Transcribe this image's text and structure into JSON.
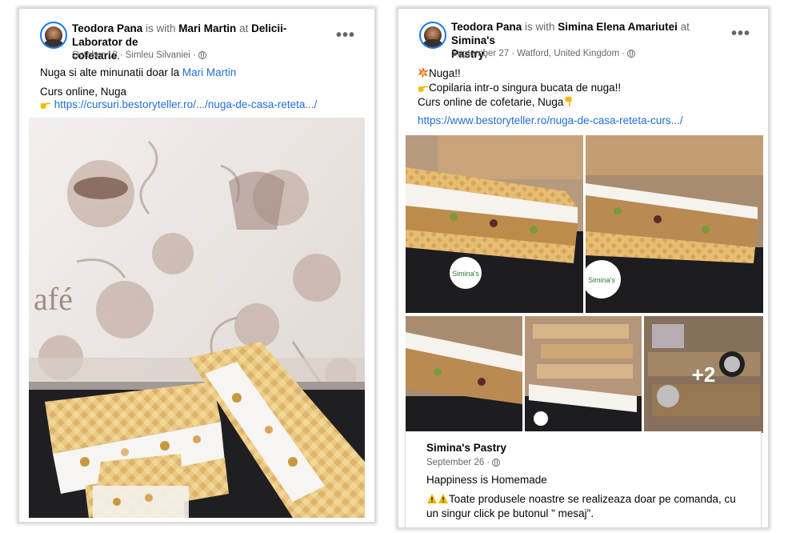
{
  "post1": {
    "author": "Teodora Pana",
    "with_text": " is with ",
    "tagged": "Mari Martin",
    "at_text": " at ",
    "location_line1": "Delicii-Laborator de",
    "location_line2": "cofetarie",
    "period": ".",
    "date": "October 18",
    "place": "Simleu Silvaniei",
    "sep": "·",
    "line1_prefix": "Nuga si alte minunatii doar la ",
    "line1_link": "Mari Martin",
    "line2": "Curs online, Nuga",
    "url": "https://cursuri.bestoryteller.ro/.../nuga-de-casa-reteta.../",
    "menu": "•••"
  },
  "post2": {
    "author": "Teodora Pana",
    "with_text": " is with ",
    "tagged": "Simina Elena Amariutei",
    "at_text": " at ",
    "location_line1": "Simina's",
    "location_line2": "Pastry",
    "period": ".",
    "date": "September 27",
    "place": "Watford, United Kingdom",
    "sep": "·",
    "line1": "Nuga!!",
    "line2": "Copilaria intr-o singura bucata de nuga!!",
    "line3": "Curs online de cofetarie, Nuga",
    "url": "https://www.bestoryteller.ro/nuga-de-casa-reteta-curs.../",
    "more_photos": "+2",
    "menu": "•••"
  },
  "shared": {
    "page": "Simina's Pastry",
    "date": "September 26",
    "sep": "·",
    "line1": "Happiness is Homemade",
    "line2": "Toate produsele noastre se realizeaza doar pe comanda, cu",
    "line3": "un singur click pe butonul \" mesaj\"."
  },
  "icons": [
    "avatar",
    "globe-icon",
    "more-options-icon",
    "collision-emoji-icon",
    "pointing-hand-icon",
    "pointing-down-hand-icon",
    "warning-icon"
  ],
  "logo": "Simina's",
  "colors": {
    "link": "#216fdb",
    "meta": "#65676b",
    "avatar_ring": "#1877f2"
  }
}
